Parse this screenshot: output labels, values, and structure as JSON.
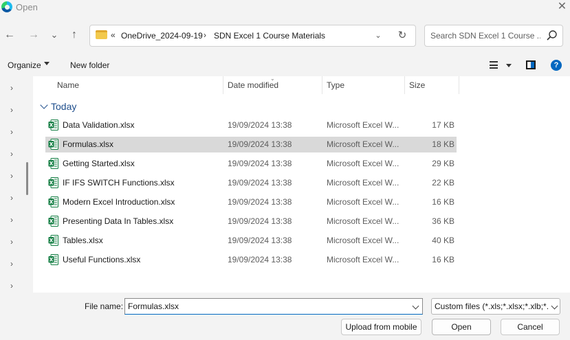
{
  "window": {
    "title": "Open",
    "close_glyph": "✕",
    "icon": "edge-browser-icon"
  },
  "nav": {
    "back_glyph": "←",
    "forward_glyph": "→",
    "recent_glyph": "⌄",
    "up_glyph": "↑"
  },
  "address": {
    "overflow_glyph": "«",
    "crumbs": [
      "OneDrive_2024-09-19",
      "SDN Excel 1 Course Materials"
    ],
    "separator": "›",
    "dropdown_glyph": "⌄",
    "refresh_glyph": "↻"
  },
  "search": {
    "placeholder": "Search SDN Excel 1 Course ..."
  },
  "toolbar": {
    "organize_label": "Organize",
    "new_folder_label": "New folder",
    "help_glyph": "?"
  },
  "columns": {
    "name": "Name",
    "date": "Date modified",
    "type": "Type",
    "size": "Size"
  },
  "group": {
    "label": "Today"
  },
  "files": [
    {
      "name": "Data Validation.xlsx",
      "date": "19/09/2024 13:38",
      "type": "Microsoft Excel W...",
      "size": "17 KB"
    },
    {
      "name": "Formulas.xlsx",
      "date": "19/09/2024 13:38",
      "type": "Microsoft Excel W...",
      "size": "18 KB"
    },
    {
      "name": "Getting Started.xlsx",
      "date": "19/09/2024 13:38",
      "type": "Microsoft Excel W...",
      "size": "29 KB"
    },
    {
      "name": "IF IFS SWITCH Functions.xlsx",
      "date": "19/09/2024 13:38",
      "type": "Microsoft Excel W...",
      "size": "22 KB"
    },
    {
      "name": "Modern Excel Introduction.xlsx",
      "date": "19/09/2024 13:38",
      "type": "Microsoft Excel W...",
      "size": "16 KB"
    },
    {
      "name": "Presenting Data In Tables.xlsx",
      "date": "19/09/2024 13:38",
      "type": "Microsoft Excel W...",
      "size": "36 KB"
    },
    {
      "name": "Tables.xlsx",
      "date": "19/09/2024 13:38",
      "type": "Microsoft Excel W...",
      "size": "40 KB"
    },
    {
      "name": "Useful Functions.xlsx",
      "date": "19/09/2024 13:38",
      "type": "Microsoft Excel W...",
      "size": "16 KB"
    }
  ],
  "selected_file_index": 1,
  "left_pane": {
    "chevron_glyph": "›",
    "chevron_count": 10
  },
  "bottom": {
    "file_name_label": "File name:",
    "file_name_value": "Formulas.xlsx",
    "filter_label": "Custom files (*.xls;*.xlsx;*.xlb;*.",
    "upload_label": "Upload from mobile",
    "open_label": "Open",
    "cancel_label": "Cancel"
  },
  "colors": {
    "accent": "#0067c0",
    "excel_green": "#107c41",
    "folder_yellow": "#f2c94c",
    "selection": "#d9d9d9",
    "group_blue": "#1f4e8c"
  }
}
